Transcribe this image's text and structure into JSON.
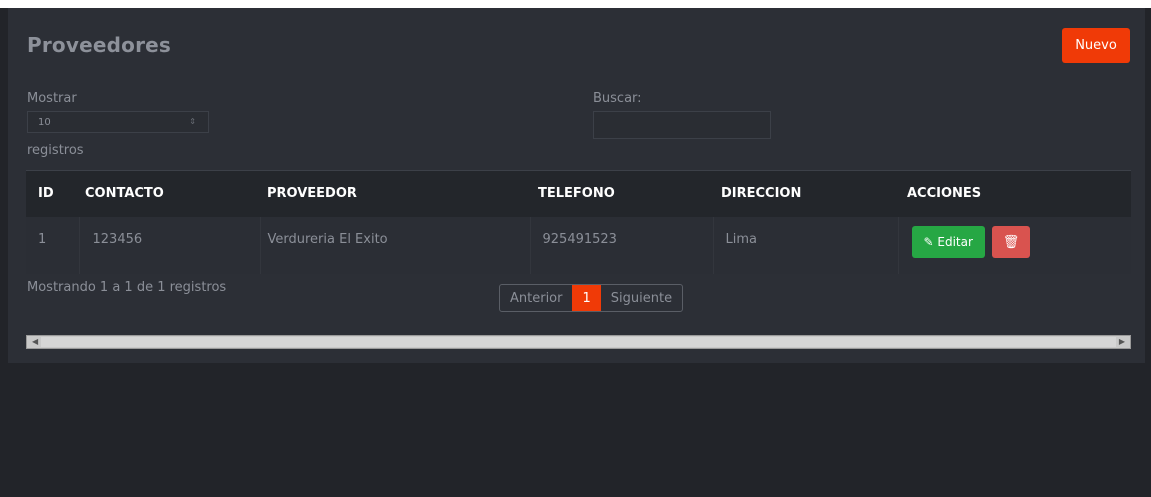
{
  "page": {
    "title": "Proveedores",
    "new_button": "Nuevo"
  },
  "filters": {
    "show_label": "Mostrar",
    "page_size": "10",
    "records_label": "registros",
    "search_label": "Buscar:"
  },
  "table": {
    "headers": [
      "ID",
      "CONTACTO",
      "PROVEEDOR",
      "TELEFONO",
      "DIRECCION",
      "ACCIONES"
    ],
    "rows": [
      {
        "id": "1",
        "contacto": "123456",
        "proveedor": "Verdureria El Exito",
        "telefono": "925491523",
        "direccion": "Lima",
        "edit_label": "Editar"
      }
    ]
  },
  "footer": {
    "info": "Mostrando 1 a 1 de 1 registros",
    "prev": "Anterior",
    "page": "1",
    "next": "Siguiente"
  },
  "colors": {
    "accent": "#f03a07",
    "edit": "#26a744",
    "delete": "#d9534f",
    "panel": "#2c2f36"
  }
}
